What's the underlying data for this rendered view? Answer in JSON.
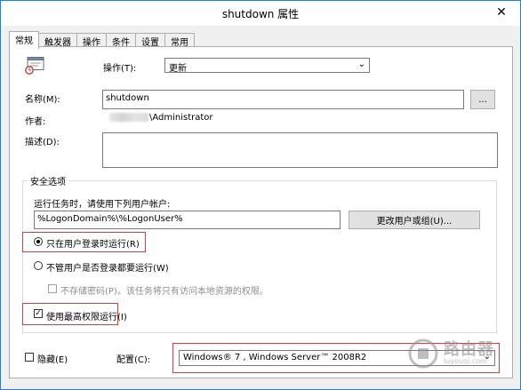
{
  "window": {
    "title": "shutdown 属性",
    "close_glyph": "✕"
  },
  "tabs": [
    "常规",
    "触发器",
    "操作",
    "条件",
    "设置",
    "常用"
  ],
  "general": {
    "action_label": "操作(T):",
    "action_value": "更新",
    "name_label": "名称(M):",
    "name_value": "shutdown",
    "browse_label": "...",
    "author_label": "作者:",
    "author_value": "\\Administrator",
    "description_label": "描述(D):",
    "description_value": ""
  },
  "security": {
    "group_title": "安全选项",
    "run_as_text": "运行任务时，请使用下列用户帐户:",
    "user_account": "%LogonDomain%\\%LogonUser%",
    "change_user_label": "更改用户或组(U)...",
    "only_logged_on_label": "只在用户登录时运行(R)",
    "whether_logged_on_label": "不管用户是否登录都要运行(W)",
    "no_store_password_label": "不存储密码(P)。该任务将只有访问本地资源的权限。",
    "highest_privileges_label": "使用最高权限运行(I)"
  },
  "footer": {
    "hidden_label": "隐藏(E)",
    "configure_label": "配置(C):",
    "configure_value": "Windows® 7 , Windows Server™ 2008R2"
  },
  "watermark": {
    "text": "路由器",
    "subtext": "luyouqi.com"
  },
  "colors": {
    "highlight": "#e03b3b",
    "window_border": "#1f7fd1"
  }
}
